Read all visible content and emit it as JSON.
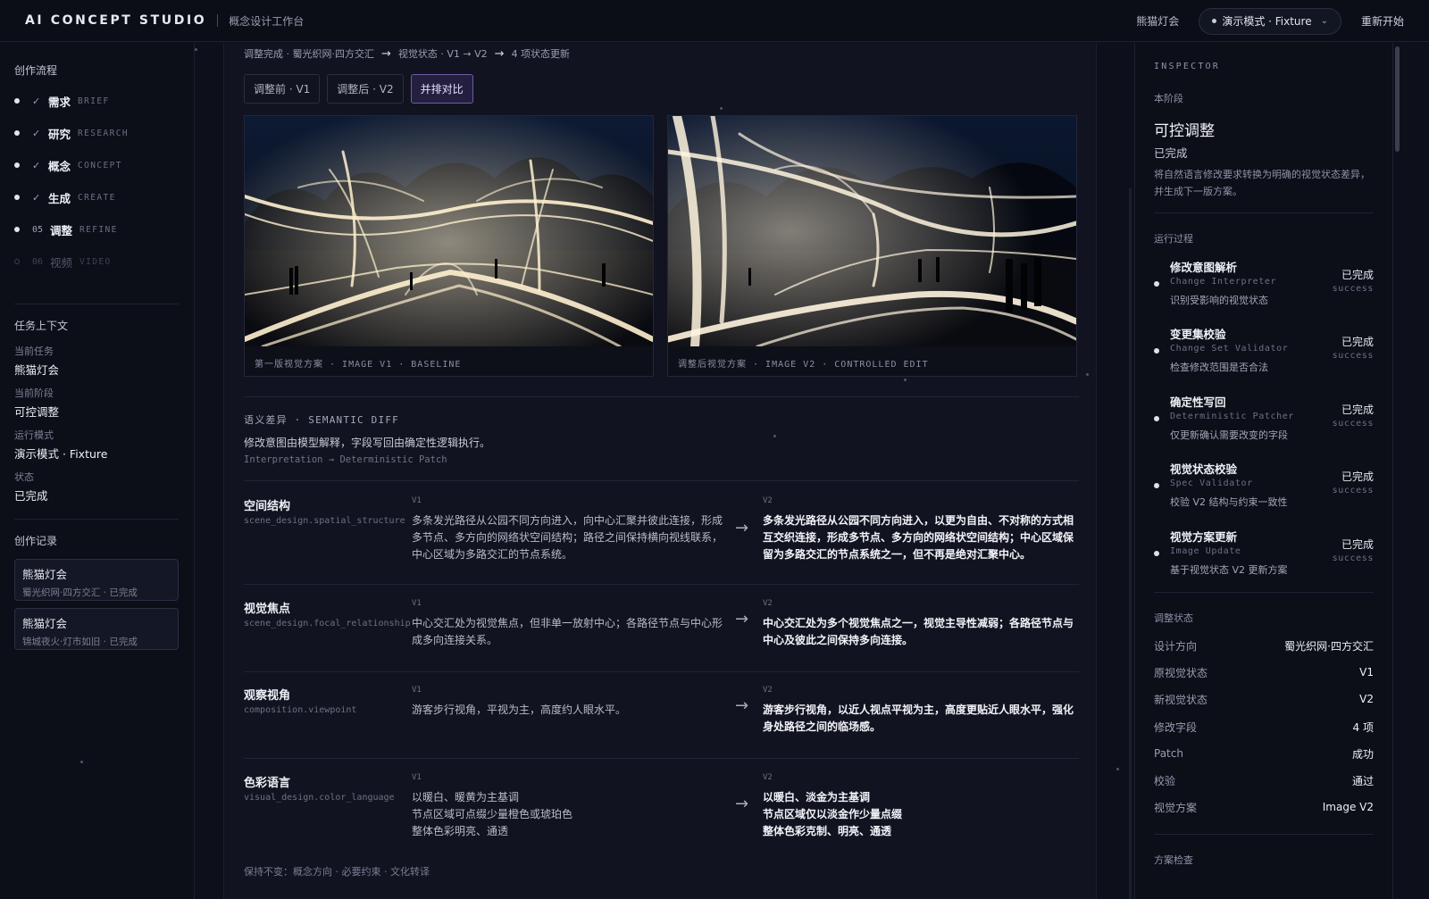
{
  "header": {
    "brand": "AI CONCEPT STUDIO",
    "subtitle": "概念设计工作台",
    "task": "熊猫灯会",
    "mode": "演示模式 · Fixture",
    "restart": "重新开始"
  },
  "sidebar": {
    "flow_title": "创作流程",
    "steps": [
      {
        "prefix": "✓",
        "cn": "需求",
        "en": "BRIEF",
        "state": "done"
      },
      {
        "prefix": "✓",
        "cn": "研究",
        "en": "RESEARCH",
        "state": "done"
      },
      {
        "prefix": "✓",
        "cn": "概念",
        "en": "CONCEPT",
        "state": "done"
      },
      {
        "prefix": "✓",
        "cn": "生成",
        "en": "CREATE",
        "state": "done"
      },
      {
        "prefix": "05",
        "cn": "调整",
        "en": "REFINE",
        "state": "current"
      },
      {
        "prefix": "06",
        "cn": "视频",
        "en": "VIDEO",
        "state": "pending"
      }
    ],
    "context_title": "任务上下文",
    "context": [
      {
        "label": "当前任务",
        "value": "熊猫灯会"
      },
      {
        "label": "当前阶段",
        "value": "可控调整"
      },
      {
        "label": "运行模式",
        "value": "演示模式 · Fixture"
      },
      {
        "label": "状态",
        "value": "已完成"
      }
    ],
    "records_title": "创作记录",
    "records": [
      {
        "title": "熊猫灯会",
        "sub": "蜀光织网·四方交汇 · 已完成"
      },
      {
        "title": "熊猫灯会",
        "sub": "锦城夜火·灯市如旧 · 已完成"
      }
    ]
  },
  "main": {
    "breadcrumb": [
      "调整完成 · 蜀光织网·四方交汇",
      "→",
      "视觉状态 · V1 → V2",
      "→",
      "4 项状态更新"
    ],
    "tabs": [
      {
        "label": "调整前 · V1",
        "active": false
      },
      {
        "label": "调整后 · V2",
        "active": false
      },
      {
        "label": "并排对比",
        "active": true
      }
    ],
    "images": [
      {
        "caption": "第一版视觉方案 · IMAGE V1 · BASELINE"
      },
      {
        "caption": "调整后视觉方案 · IMAGE V2 · CONTROLLED EDIT"
      }
    ],
    "semantic_diff": {
      "title": "语义差异 · SEMANTIC DIFF",
      "desc": "修改意图由模型解释，字段写回由确定性逻辑执行。",
      "sub": "Interpretation → Deterministic Patch"
    },
    "v1_tag": "V1",
    "v2_tag": "V2",
    "arrow": "→",
    "diffs": [
      {
        "label": "空间结构",
        "key": "scene_design.spatial_structure",
        "v1": "多条发光路径从公园不同方向进入，向中心汇聚并彼此连接，形成多节点、多方向的网络状空间结构；路径之间保持横向视线联系，中心区域为多路交汇的节点系统。",
        "v2": "多条发光路径从公园不同方向进入，以更为自由、不对称的方式相互交织连接，形成多节点、多方向的网络状空间结构；中心区域保留为多路交汇的节点系统之一，但不再是绝对汇聚中心。"
      },
      {
        "label": "视觉焦点",
        "key": "scene_design.focal_relationship",
        "v1": "中心交汇处为视觉焦点，但非单一放射中心；各路径节点与中心形成多向连接关系。",
        "v2": "中心交汇处为多个视觉焦点之一，视觉主导性减弱；各路径节点与中心及彼此之间保持多向连接。"
      },
      {
        "label": "观察视角",
        "key": "composition.viewpoint",
        "v1": "游客步行视角，平视为主，高度约人眼水平。",
        "v2": "游客步行视角，以近人视点平视为主，高度更贴近人眼水平，强化身处路径之间的临场感。"
      },
      {
        "label": "色彩语言",
        "key": "visual_design.color_language",
        "v1_lines": [
          "以暖白、暖黄为主基调",
          "节点区域可点缀少量橙色或琥珀色",
          "整体色彩明亮、通透"
        ],
        "v2_lines": [
          "以暖白、淡金为主基调",
          "节点区域仅以淡金作少量点缀",
          "整体色彩克制、明亮、通透"
        ]
      }
    ],
    "keep": "保持不变：概念方向 · 必要约束 · 文化转译"
  },
  "inspector": {
    "tag": "INSPECTOR",
    "stage_label": "本阶段",
    "stage_title": "可控调整",
    "stage_state": "已完成",
    "stage_desc": "将自然语言修改要求转换为明确的视觉状态差异，并生成下一版方案。",
    "process_title": "运行过程",
    "process": [
      {
        "name": "修改意图解析",
        "en": "Change Interpreter",
        "desc": "识别受影响的视觉状态",
        "status": "已完成",
        "status_en": "success"
      },
      {
        "name": "变更集校验",
        "en": "Change Set Validator",
        "desc": "检查修改范围是否合法",
        "status": "已完成",
        "status_en": "success"
      },
      {
        "name": "确定性写回",
        "en": "Deterministic Patcher",
        "desc": "仅更新确认需要改变的字段",
        "status": "已完成",
        "status_en": "success"
      },
      {
        "name": "视觉状态校验",
        "en": "Spec Validator",
        "desc": "校验 V2 结构与约束一致性",
        "status": "已完成",
        "status_en": "success"
      },
      {
        "name": "视觉方案更新",
        "en": "Image Update",
        "desc": "基于视觉状态 V2 更新方案",
        "status": "已完成",
        "status_en": "success"
      }
    ],
    "adjust_title": "调整状态",
    "adjust": [
      {
        "k": "设计方向",
        "v": "蜀光织网·四方交汇"
      },
      {
        "k": "原视觉状态",
        "v": "V1"
      },
      {
        "k": "新视觉状态",
        "v": "V2"
      },
      {
        "k": "修改字段",
        "v": "4 项"
      },
      {
        "k": "Patch",
        "v": "成功"
      },
      {
        "k": "校验",
        "v": "通过"
      },
      {
        "k": "视觉方案",
        "v": "Image V2"
      }
    ],
    "check_title": "方案检查"
  },
  "colors": {
    "accent": "#6c5ca6",
    "bg": "#0d0f1a",
    "glow": "#fff1cf"
  }
}
